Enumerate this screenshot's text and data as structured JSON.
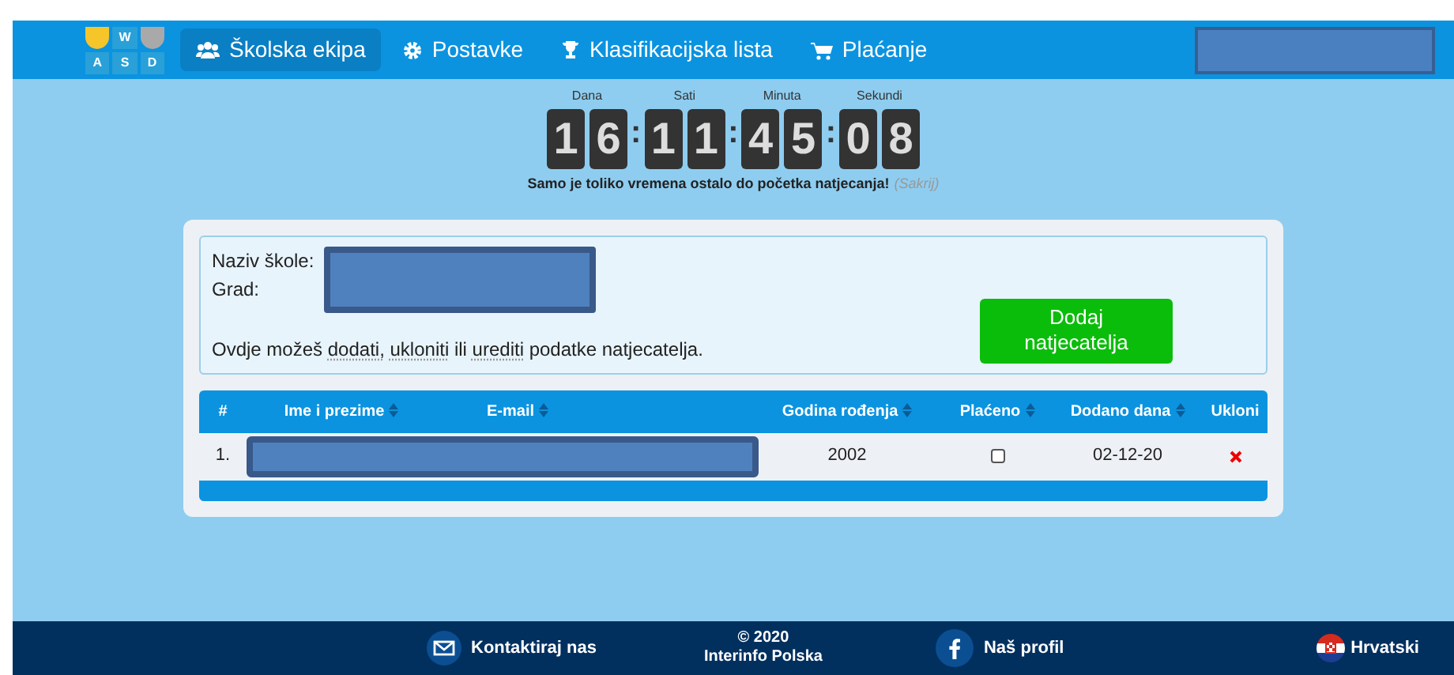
{
  "logo": {
    "letters": [
      "W",
      "A",
      "S",
      "D"
    ]
  },
  "nav": [
    {
      "label": "Školska ekipa",
      "selected": true
    },
    {
      "label": "Postavke",
      "selected": false
    },
    {
      "label": "Klasifikacijska lista",
      "selected": false
    },
    {
      "label": "Plaćanje",
      "selected": false
    }
  ],
  "countdown": {
    "units": [
      {
        "label": "Dana",
        "digits": [
          "1",
          "6"
        ]
      },
      {
        "label": "Sati",
        "digits": [
          "1",
          "1"
        ]
      },
      {
        "label": "Minuta",
        "digits": [
          "4",
          "5"
        ]
      },
      {
        "label": "Sekundi",
        "digits": [
          "0",
          "8"
        ]
      }
    ],
    "separator": ":",
    "message": "Samo je toliko vremena ostalo do početka natjecanja!",
    "hide_link": "(Sakrij)"
  },
  "school": {
    "labels": [
      "Naziv škole:",
      "Grad:"
    ],
    "info_parts": [
      "Ovdje možeš",
      "dodati,",
      "ukloniti",
      "ili",
      "urediti",
      "podatke natjecatelja."
    ],
    "add_button": "Dodaj natjecatelja"
  },
  "table": {
    "columns": [
      {
        "label": "#",
        "sortable": false
      },
      {
        "label": "Ime i prezime",
        "sortable": true
      },
      {
        "label": "E-mail",
        "sortable": true
      },
      {
        "label": "Godina rođenja",
        "sortable": true
      },
      {
        "label": "Plaćeno",
        "sortable": true
      },
      {
        "label": "Dodano dana",
        "sortable": true
      },
      {
        "label": "Ukloni",
        "sortable": false
      }
    ],
    "rows": [
      {
        "number": "1.",
        "birth_year": "2002",
        "paid": false,
        "added": "02-12-20"
      }
    ]
  },
  "footer": {
    "contact": "Kontaktiraj nas",
    "copyright": [
      "© 2020",
      "Interinfo Polska"
    ],
    "profile": "Naš profil",
    "language": "Hrvatski"
  }
}
